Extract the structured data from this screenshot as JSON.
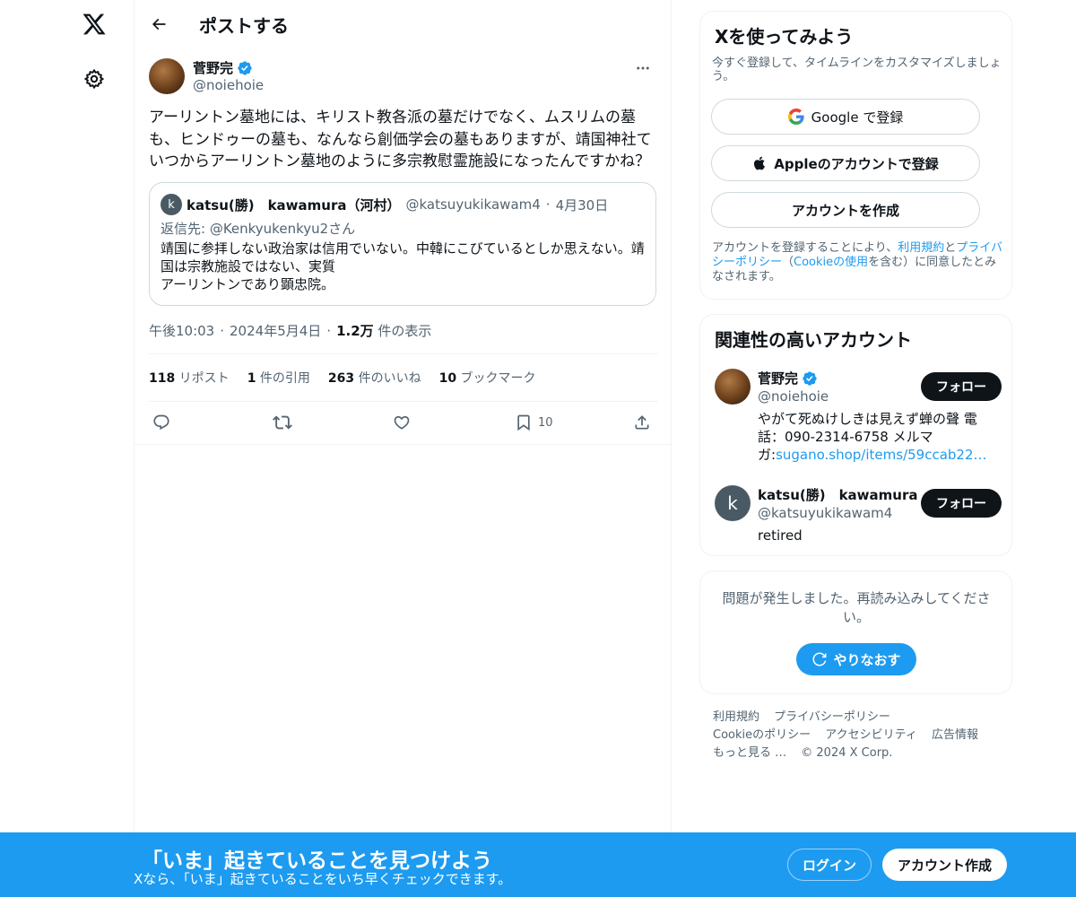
{
  "colors": {
    "accent": "#1d9bf0",
    "text": "#0f1419",
    "secondary": "#536471"
  },
  "left_rail": {
    "logo_icon": "x-logo-icon",
    "settings_icon": "gear-icon"
  },
  "header": {
    "title": "ポストする",
    "back_icon": "arrow-left-icon"
  },
  "tweet": {
    "author_name": "菅野完",
    "author_handle": "@noiehoie",
    "text": "アーリントン墓地には、キリスト教各派の墓だけでなく、ムスリムの墓も、ヒンドゥーの墓も、なんなら創価学会の墓もありますが、靖国神社ていつからアーリントン墓地のように多宗教慰霊施設になったんですかね？",
    "time": "午後10:03",
    "date": "2024年5月4日",
    "views_count": "1.2万",
    "views_label": "件の表示"
  },
  "quote": {
    "avatar_letter": "k",
    "name": "katsu(勝)　kawamura（河村）",
    "handle": "@katsuyukikawam4",
    "date": "4月30日",
    "reply_to": "返信先: @Kenkyukenkyu2さん",
    "body_lines": [
      "靖国に参拝しない政治家は信用でいない。中韓にこびているとしか思えない。靖",
      "国は宗教施設ではない、実質",
      "アーリントンであり顕忠院。"
    ]
  },
  "stats": {
    "reposts_count": "118",
    "reposts_label": "リポスト",
    "quotes_count": "1",
    "quotes_label": "件の引用",
    "likes_count": "263",
    "likes_label": "件のいいね",
    "bookmarks_count": "10",
    "bookmarks_label": "ブックマーク"
  },
  "actions": {
    "bookmark_count": "10"
  },
  "signup_card": {
    "title": "Xを使ってみよう",
    "subtitle": "今すぐ登録して、タイムラインをカスタマイズしましょう。",
    "google_label": "Google で登録",
    "apple_label": "Appleのアカウントで登録",
    "create_label": "アカウントを作成",
    "legal_prefix": "アカウントを登録することにより、",
    "terms_link": "利用規約",
    "legal_and": "と",
    "privacy_link": "プライバシーポリシー",
    "legal_mid": "（",
    "cookie_link": "Cookieの使用",
    "legal_suffix": "を含む）に同意したとみなされます。"
  },
  "related": {
    "title": "関連性の高いアカウント",
    "accounts": [
      {
        "name": "菅野完",
        "handle": "@noiehoie",
        "bio": "やがて死ぬけしきは見えず蝉の聲 電話：090-2314-6758 メルマガ:",
        "bio_link": "sugano.shop/items/59ccab22…",
        "follow_label": "フォロー"
      },
      {
        "avatar_letter": "k",
        "name": "katsu(勝)　kawamura",
        "handle": "@katsuyukikawam4",
        "bio": "retired",
        "follow_label": "フォロー"
      }
    ]
  },
  "trends_error": {
    "message": "問題が発生しました。再読み込みしてください。",
    "retry_label": "やりなおす"
  },
  "footer": {
    "links": [
      "利用規約",
      "プライバシーポリシー",
      "Cookieのポリシー",
      "アクセシビリティ",
      "広告情報",
      "もっと見る …"
    ],
    "copyright": "© 2024 X Corp."
  },
  "banner": {
    "title": "「いま」起きていることを見つけよう",
    "subtitle": "Xなら、「いま」起きていることをいち早くチェックできます。",
    "login_label": "ログイン",
    "signup_label": "アカウント作成"
  }
}
